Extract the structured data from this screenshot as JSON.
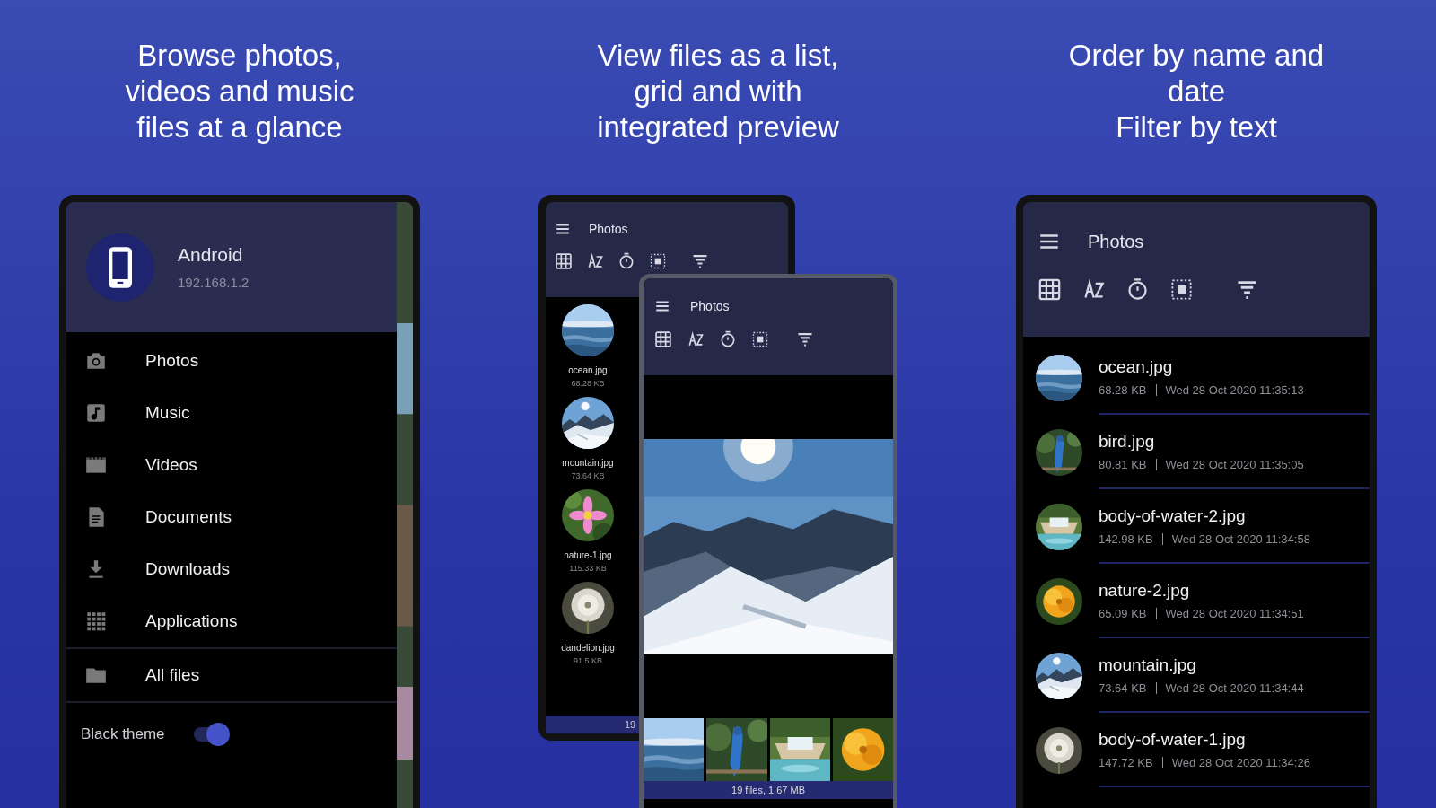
{
  "captions": [
    "Browse photos,\nvideos and music\nfiles at a glance",
    "View files as a list,\ngrid and with\nintegrated preview",
    "Order by name and\ndate\nFilter by text"
  ],
  "drawer": {
    "title": "Android",
    "subtitle": "192.168.1.2",
    "items": [
      {
        "label": "Photos"
      },
      {
        "label": "Music"
      },
      {
        "label": "Videos"
      },
      {
        "label": "Documents"
      },
      {
        "label": "Downloads"
      },
      {
        "label": "Applications"
      }
    ],
    "all_files": {
      "label": "All files"
    },
    "black_theme": {
      "label": "Black theme",
      "on": true
    }
  },
  "grid_phone": {
    "title": "Photos",
    "items": [
      {
        "name": "ocean.jpg",
        "size": "68.28 KB"
      },
      {
        "name": "mountain.jpg",
        "size": "73.64 KB"
      },
      {
        "name": "nature-1.jpg",
        "size": "115.33 KB"
      },
      {
        "name": "dandelion.jpg",
        "size": "91.5 KB"
      }
    ],
    "footer": "19"
  },
  "preview_phone": {
    "title": "Photos",
    "footer": "19 files, 1.67 MB"
  },
  "list_phone": {
    "title": "Photos",
    "rows": [
      {
        "name": "ocean.jpg",
        "size": "68.28 KB",
        "date": "Wed 28 Oct 2020 11:35:13"
      },
      {
        "name": "bird.jpg",
        "size": "80.81 KB",
        "date": "Wed 28 Oct 2020 11:35:05"
      },
      {
        "name": "body-of-water-2.jpg",
        "size": "142.98 KB",
        "date": "Wed 28 Oct 2020 11:34:58"
      },
      {
        "name": "nature-2.jpg",
        "size": "65.09 KB",
        "date": "Wed 28 Oct 2020 11:34:51"
      },
      {
        "name": "mountain.jpg",
        "size": "73.64 KB",
        "date": "Wed 28 Oct 2020 11:34:44"
      },
      {
        "name": "body-of-water-1.jpg",
        "size": "147.72 KB",
        "date": "Wed 28 Oct 2020 11:34:26"
      }
    ]
  }
}
